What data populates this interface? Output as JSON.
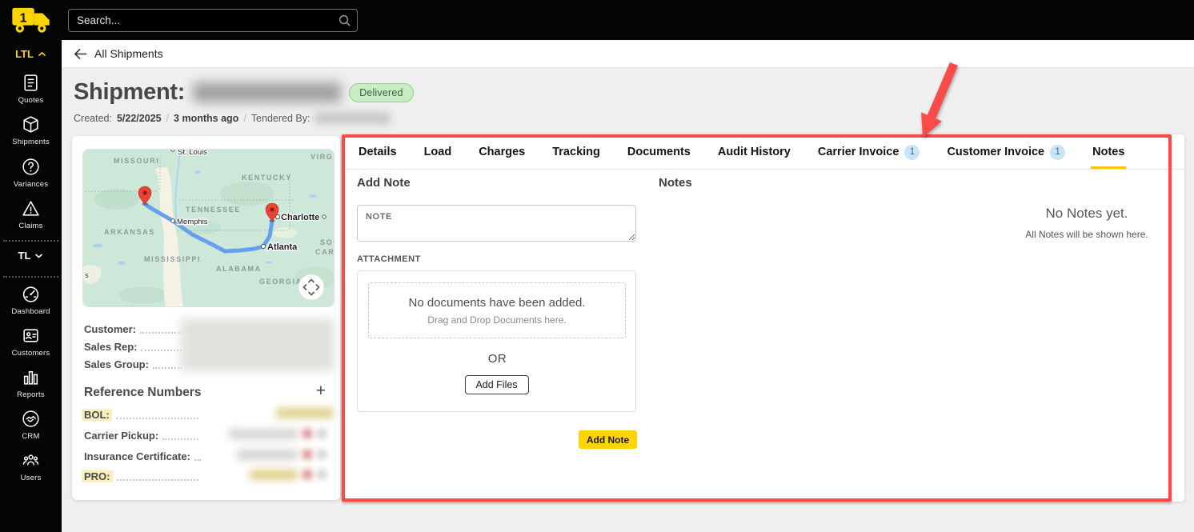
{
  "topbar": {
    "search_placeholder": "Search..."
  },
  "sidebar": {
    "sections": [
      {
        "label": "LTL",
        "chevron": "up",
        "items": [
          {
            "label": "Quotes"
          },
          {
            "label": "Shipments"
          },
          {
            "label": "Variances"
          },
          {
            "label": "Claims"
          }
        ]
      },
      {
        "label": "TL",
        "chevron": "down",
        "items": [
          {
            "label": "Dashboard"
          },
          {
            "label": "Customers"
          },
          {
            "label": "Reports"
          },
          {
            "label": "CRM"
          },
          {
            "label": "Users"
          }
        ]
      }
    ]
  },
  "breadcrumb": {
    "back": "All Shipments"
  },
  "header": {
    "title": "Shipment:",
    "status_badge": "Delivered",
    "created_label": "Created:",
    "created_date": "5/22/2025",
    "separator": "/",
    "created_relative": "3 months ago",
    "tendered_by_label": "Tendered By:"
  },
  "map": {
    "states": [
      "MISSOURI",
      "KENTUCKY",
      "TENNESSEE",
      "ARKANSAS",
      "MISSISSIPPI",
      "ALABAMA",
      "GEORGIA",
      "VIRGINI",
      "SOUT",
      "CAROL"
    ],
    "cities": [
      "St. Louis",
      "Memphis",
      "Atlanta",
      "Charlotte"
    ],
    "fragment": "s"
  },
  "shipment_panel": {
    "fields": [
      {
        "label": "Customer:"
      },
      {
        "label": "Sales Rep:"
      },
      {
        "label": "Sales Group:"
      }
    ],
    "reference_numbers": {
      "title": "Reference Numbers",
      "add_button": "+",
      "rows": [
        {
          "label": "BOL:",
          "highlighted": true
        },
        {
          "label": "Carrier Pickup:",
          "highlighted": false
        },
        {
          "label": "Insurance Certificate:",
          "highlighted": false
        },
        {
          "label": "PRO:",
          "highlighted": true
        }
      ]
    }
  },
  "tabs": [
    {
      "label": "Details"
    },
    {
      "label": "Load"
    },
    {
      "label": "Charges"
    },
    {
      "label": "Tracking"
    },
    {
      "label": "Documents"
    },
    {
      "label": "Audit History"
    },
    {
      "label": "Carrier Invoice",
      "badge": "1"
    },
    {
      "label": "Customer Invoice",
      "badge": "1"
    },
    {
      "label": "Notes",
      "active": true
    }
  ],
  "notes_tab": {
    "add_note_title": "Add Note",
    "note_placeholder": "NOTE",
    "attachment_label": "ATTACHMENT",
    "dropzone_title": "No documents have been added.",
    "dropzone_subtitle": "Drag and Drop Documents here.",
    "or_label": "OR",
    "add_files_button": "Add Files",
    "add_note_button": "Add Note",
    "notes_title": "Notes",
    "empty_title": "No Notes yet.",
    "empty_subtitle": "All Notes will be shown here."
  },
  "colors": {
    "accent_yellow": "#ffd400",
    "annotation_red": "#fa4a4a",
    "delivered_green_bg": "#c9ecc4",
    "delivered_green_border": "#8fd08a",
    "badge_blue_bg": "#c9e4f5",
    "badge_blue_text": "#2c6e9e",
    "topbar_black": "#040404"
  }
}
